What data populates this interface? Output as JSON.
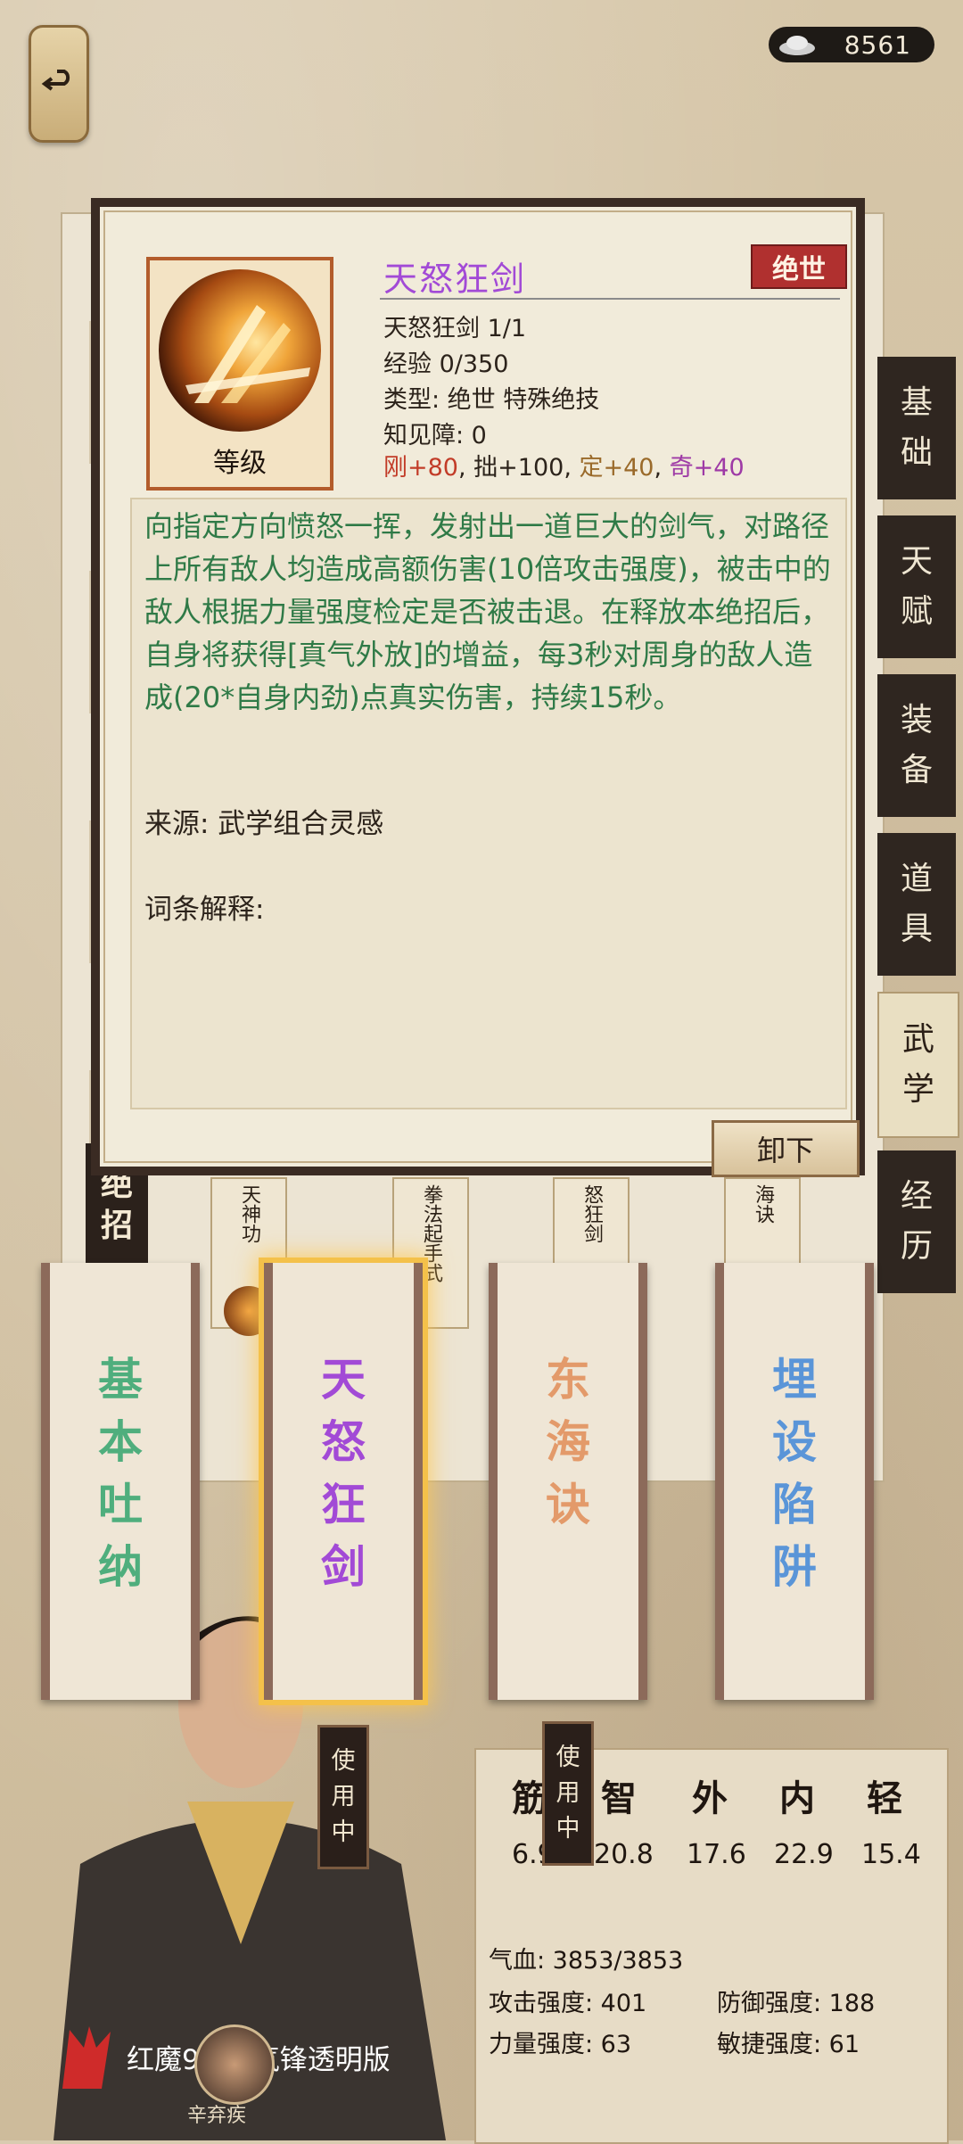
{
  "topbar": {
    "currency_value": "8561"
  },
  "popup": {
    "skill_name": "天怒狂剑",
    "rarity": "绝世",
    "level_label": "等级",
    "lines": [
      "天怒狂剑 1/1",
      "经验 0/350",
      "类型: 绝世 特殊绝技",
      "知见障: 0"
    ],
    "attributes": {
      "gang": "刚+80",
      "sep1": ", ",
      "zhuo": "拙+100",
      "sep2": ", ",
      "ding": "定+40",
      "sep3": ", ",
      "qi": "奇+40"
    },
    "description": "向指定方向愤怒一挥，发射出一道巨大的剑气，对路径上所有敌人均造成高额伤害(10倍攻击强度)，被击中的敌人根据力量强度检定是否被击退。在释放本绝招后，自身将获得[真气外放]的增益，每3秒对周身的敌人造成(20*自身内劲)点真实伤害，持续15秒。",
    "source": "来源: 武学组合灵感",
    "terms": "词条解释:",
    "unload_button": "卸下"
  },
  "tabs": [
    {
      "c1": "基",
      "c2": "础"
    },
    {
      "c1": "天",
      "c2": "赋"
    },
    {
      "c1": "装",
      "c2": "备"
    },
    {
      "c1": "道",
      "c2": "具"
    },
    {
      "c1": "武",
      "c2": "学"
    },
    {
      "c1": "经",
      "c2": "历"
    }
  ],
  "background_list": {
    "left_label": {
      "c1": "绝",
      "c2": "招"
    },
    "stubs": [
      {
        "t": "天神功"
      },
      {
        "t": "拳法起手式"
      },
      {
        "t": "怒狂剑"
      },
      {
        "t": "海诀"
      }
    ]
  },
  "scrolls": [
    {
      "chars": [
        "基",
        "本",
        "吐",
        "纳"
      ],
      "color": "#4fae7d"
    },
    {
      "chars": [
        "天",
        "怒",
        "狂",
        "剑"
      ],
      "color": "#a24ad6"
    },
    {
      "chars": [
        "东",
        "海",
        "诀"
      ],
      "color": "#e39a6a"
    },
    {
      "chars": [
        "埋",
        "设",
        "陷",
        "阱"
      ],
      "color": "#5a95d8"
    }
  ],
  "in_use_tag": {
    "l1": "使",
    "l2": "用",
    "l3": "中"
  },
  "stats": {
    "headers": [
      "筋",
      "智",
      "外",
      "内",
      "轻"
    ],
    "values": [
      "6.9",
      "20.8",
      "17.6",
      "22.9",
      "15.4"
    ],
    "hp": "气血: 3853/3853",
    "attack": "攻击强度: 401",
    "defense": "防御强度: 188",
    "strength": "力量强度: 63",
    "agility": "敏捷强度: 61"
  },
  "watermark": "红魔9 Pro氘锋透明版",
  "avatar_name": "辛弃疾"
}
